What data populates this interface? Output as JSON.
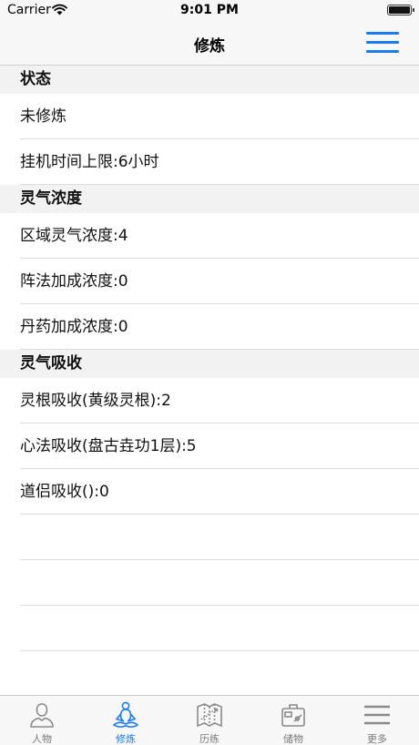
{
  "status_bar": {
    "carrier": "Carrier",
    "time": "9:01 PM"
  },
  "nav": {
    "title": "修炼"
  },
  "sections": [
    {
      "header": "状态",
      "rows": [
        "未修炼",
        "挂机时间上限:6小时"
      ]
    },
    {
      "header": "灵气浓度",
      "rows": [
        "区域灵气浓度:4",
        "阵法加成浓度:0",
        "丹药加成浓度:0"
      ]
    },
    {
      "header": "灵气吸收",
      "rows": [
        "灵根吸收(黄级灵根):2",
        "心法吸收(盘古垚功1层):5",
        "道侣吸收():0"
      ]
    }
  ],
  "tabs": [
    {
      "label": "人物",
      "icon": "person-icon"
    },
    {
      "label": "修炼",
      "icon": "meditation-icon"
    },
    {
      "label": "历练",
      "icon": "map-icon"
    },
    {
      "label": "储物",
      "icon": "bag-icon"
    },
    {
      "label": "更多",
      "icon": "more-icon"
    }
  ],
  "active_tab_index": 1,
  "colors": {
    "accent": "#1a7cf5",
    "inactive": "#7a7a7a",
    "section_bg": "#f2f2f2",
    "bar_bg": "#f7f7f7"
  }
}
